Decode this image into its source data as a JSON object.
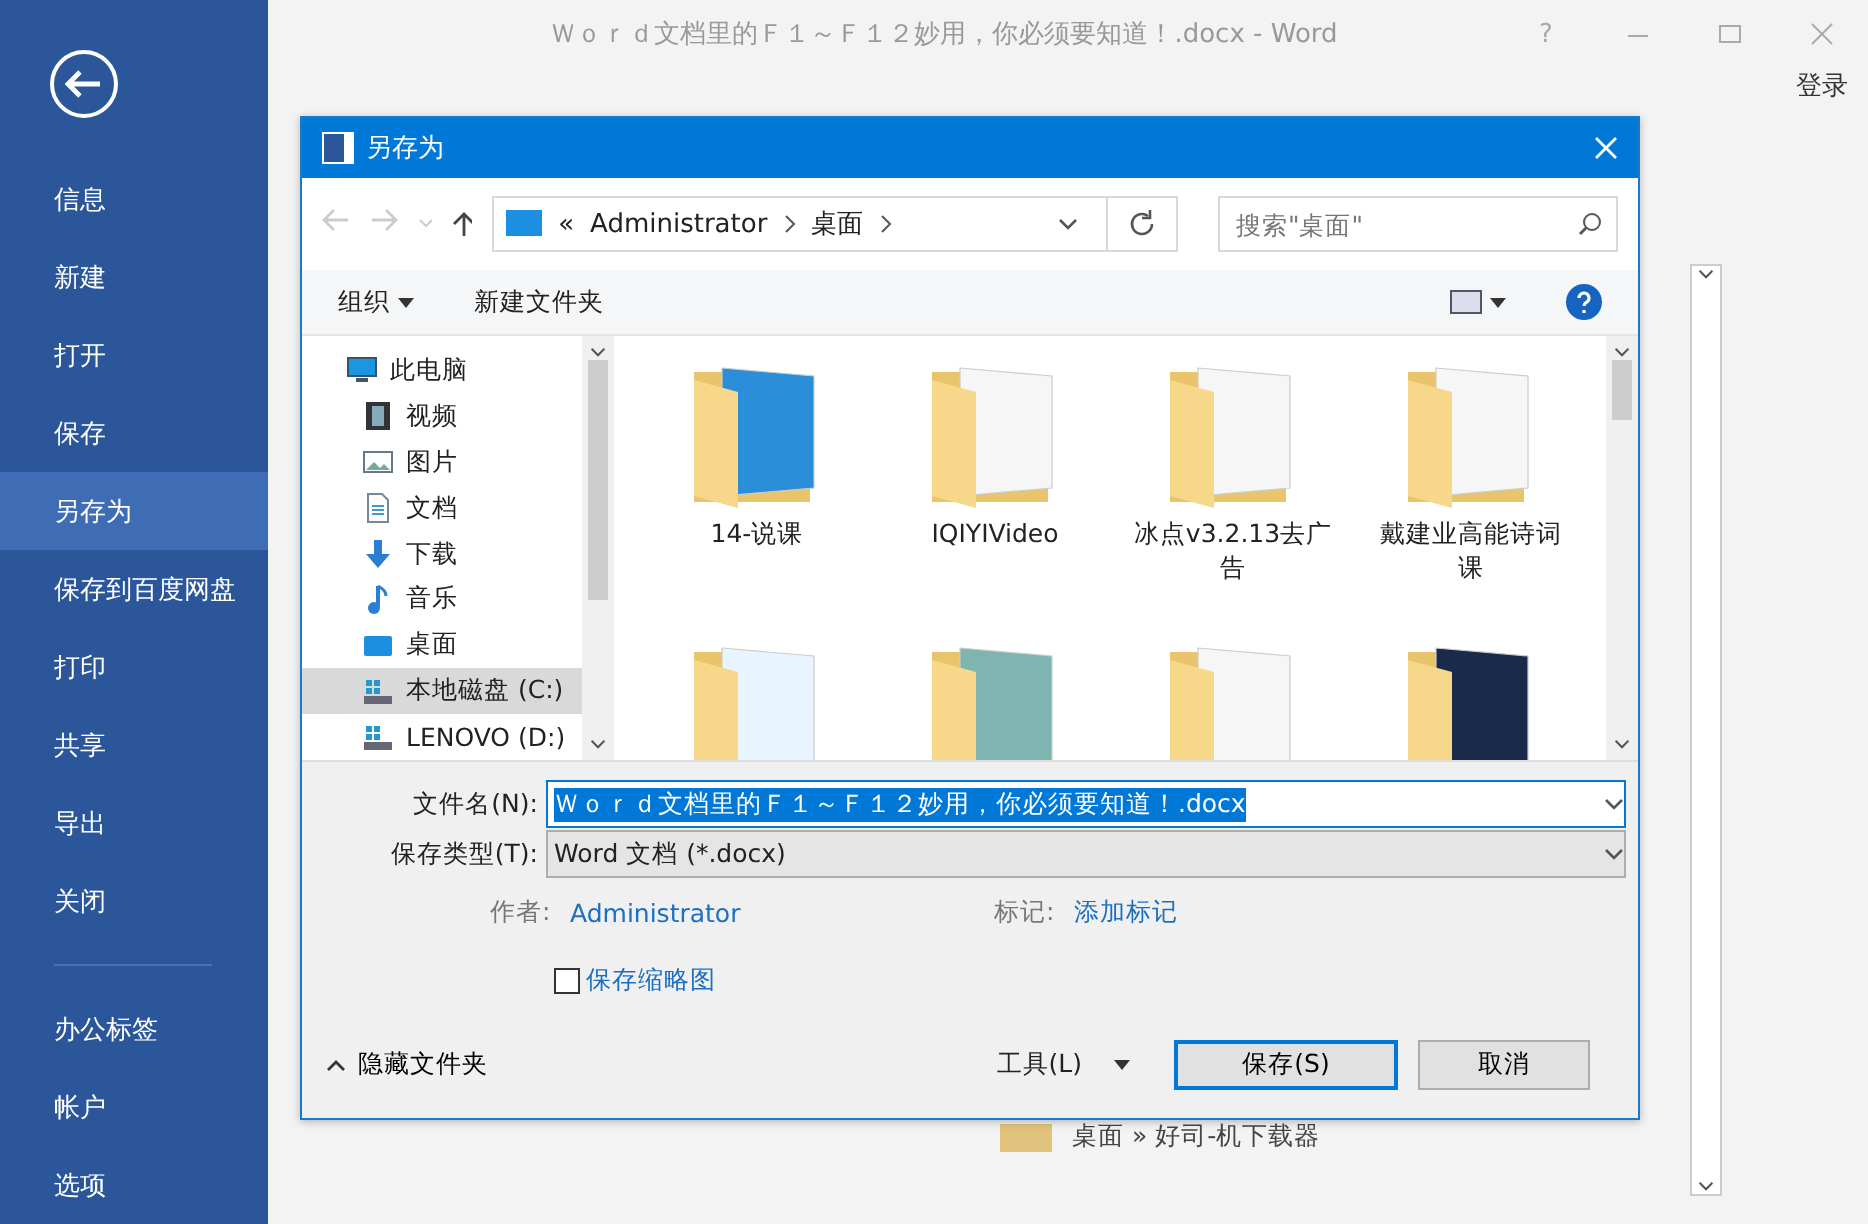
{
  "word": {
    "title": "Ｗｏｒｄ文档里的Ｆ１～Ｆ１２妙用，你必须要知道！.docx - Word",
    "help": "?",
    "sign_in": "登录"
  },
  "backstage": {
    "items": [
      {
        "label": "信息",
        "selected": false
      },
      {
        "label": "新建",
        "selected": false
      },
      {
        "label": "打开",
        "selected": false
      },
      {
        "label": "保存",
        "selected": false
      },
      {
        "label": "另存为",
        "selected": true
      },
      {
        "label": "保存到百度网盘",
        "selected": false
      },
      {
        "label": "打印",
        "selected": false
      },
      {
        "label": "共享",
        "selected": false
      },
      {
        "label": "导出",
        "selected": false
      },
      {
        "label": "关闭",
        "selected": false
      }
    ],
    "bottom_items": [
      {
        "label": "办公标签",
        "selected": false
      },
      {
        "label": "帐户",
        "selected": false
      },
      {
        "label": "选项",
        "selected": false
      }
    ]
  },
  "recent": {
    "path": "桌面 » 好司-机下载器"
  },
  "dialog": {
    "title": "另存为",
    "address": {
      "overflow": "«",
      "crumbs": [
        "Administrator",
        "桌面"
      ]
    },
    "search": {
      "placeholder": "搜索\"桌面\""
    },
    "toolbar": {
      "organize": "组织",
      "new_folder": "新建文件夹"
    },
    "nav": [
      {
        "label": "此电脑",
        "kind": "pc",
        "selected": false,
        "children": [
          {
            "label": "视频",
            "kind": "video",
            "selected": false
          },
          {
            "label": "图片",
            "kind": "picture",
            "selected": false
          },
          {
            "label": "文档",
            "kind": "document",
            "selected": false
          },
          {
            "label": "下载",
            "kind": "download",
            "selected": false
          },
          {
            "label": "音乐",
            "kind": "music",
            "selected": false
          },
          {
            "label": "桌面",
            "kind": "desktop",
            "selected": false
          },
          {
            "label": "本地磁盘 (C:)",
            "kind": "drive",
            "selected": true
          },
          {
            "label": "LENOVO (D:)",
            "kind": "drive",
            "selected": false
          }
        ]
      }
    ],
    "files": [
      {
        "name": "14-说课",
        "kind": "blue"
      },
      {
        "name": "IQIYIVideo",
        "kind": "paper"
      },
      {
        "name": "冰点v3.2.13去广告",
        "kind": "paper"
      },
      {
        "name": "戴建业高能诗词课",
        "kind": "paper"
      },
      {
        "kind": "poster"
      },
      {
        "kind": "teal"
      },
      {
        "kind": "paper"
      },
      {
        "kind": "dark"
      }
    ],
    "filename": {
      "label": "文件名(N):",
      "value": "Ｗｏｒｄ文档里的Ｆ１～Ｆ１２妙用，你必须要知道！.docx",
      "selected": true
    },
    "filetype": {
      "label": "保存类型(T):",
      "value": "Word 文档 (*.docx)"
    },
    "author": {
      "label": "作者:",
      "value": "Administrator"
    },
    "tags": {
      "label": "标记:",
      "value": "添加标记"
    },
    "thumbnail": {
      "label": "保存缩略图",
      "checked": false
    },
    "hide_folders": "隐藏文件夹",
    "tools": "工具(L)",
    "save": "保存(S)",
    "cancel": "取消"
  }
}
